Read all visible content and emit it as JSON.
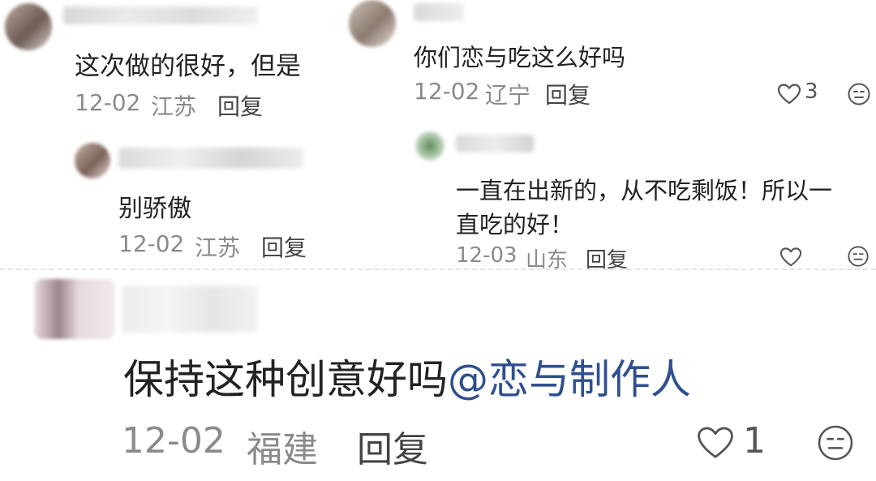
{
  "comments": [
    {
      "text": "这次做的很好，但是",
      "date": "12-02",
      "region": "江苏",
      "reply_label": "回复"
    },
    {
      "text": "别骄傲",
      "date": "12-02",
      "region": "江苏",
      "reply_label": "回复"
    },
    {
      "text": "你们恋与吃这么好吗",
      "date": "12-02",
      "region": "辽宁",
      "reply_label": "回复",
      "like_count": "3"
    },
    {
      "text_line1": "一直在出新的，从不吃剩饭！所以一",
      "text_line2": "直吃的好！",
      "date": "12-03",
      "region": "山东",
      "reply_label": "回复"
    },
    {
      "text": "保持这种创意好吗",
      "mention": "@恋与制作人",
      "date": "12-02",
      "region": "福建",
      "reply_label": "回复",
      "like_count": "1"
    }
  ],
  "icons": [
    "heart-icon",
    "emoji-face-icon"
  ],
  "colors": {
    "meta": "#8a8a8a",
    "mention": "#2f4f8f",
    "icon": "#555555"
  }
}
